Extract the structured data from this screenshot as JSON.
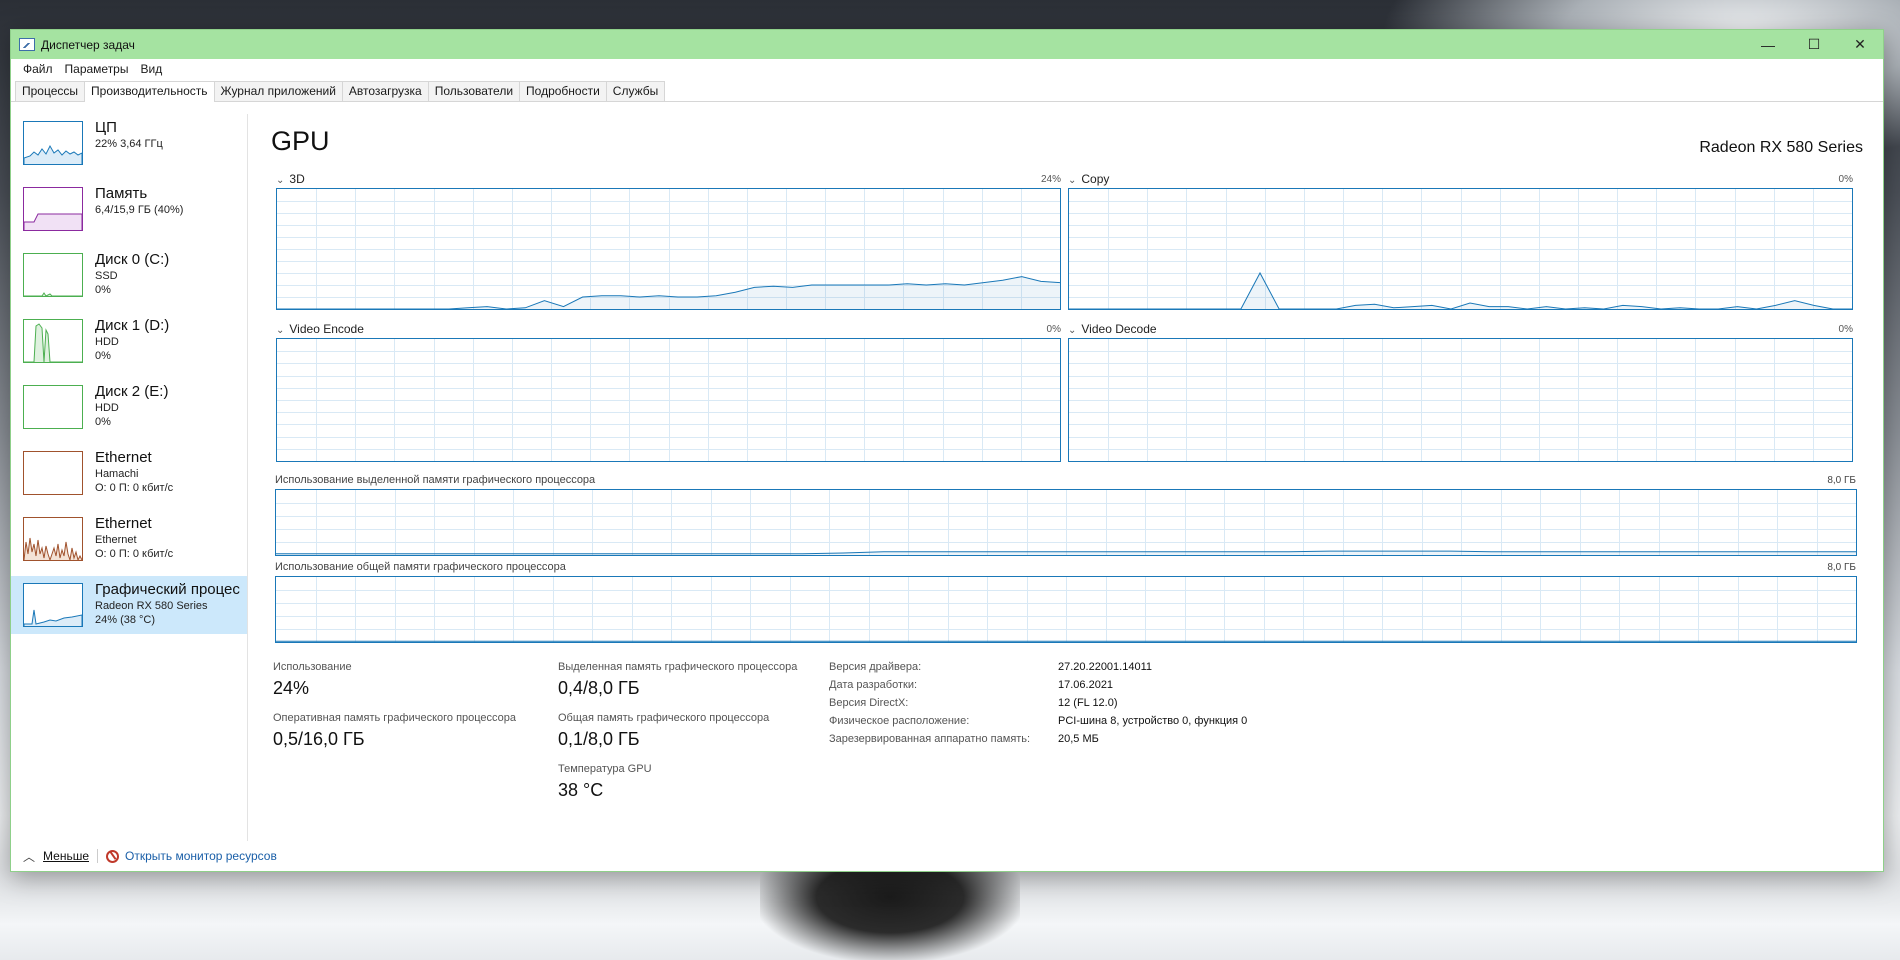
{
  "window": {
    "title": "Диспетчер задач",
    "controls": [
      "—",
      "☐",
      "✕"
    ]
  },
  "menu": [
    "Файл",
    "Параметры",
    "Вид"
  ],
  "tabs": [
    "Процессы",
    "Производительность",
    "Журнал приложений",
    "Автозагрузка",
    "Пользователи",
    "Подробности",
    "Службы"
  ],
  "active_tab": 1,
  "sidebar": [
    {
      "title": "ЦП",
      "line1": "22% 3,64 ГГц",
      "line2": "",
      "color": "#1a78b8"
    },
    {
      "title": "Память",
      "line1": "6,4/15,9 ГБ (40%)",
      "line2": "",
      "color": "#8b2a9f"
    },
    {
      "title": "Диск 0 (C:)",
      "line1": "SSD",
      "line2": "0%",
      "color": "#4caf50"
    },
    {
      "title": "Диск 1 (D:)",
      "line1": "HDD",
      "line2": "0%",
      "color": "#4caf50"
    },
    {
      "title": "Диск 2 (E:)",
      "line1": "HDD",
      "line2": "0%",
      "color": "#4caf50"
    },
    {
      "title": "Ethernet",
      "line1": "Hamachi",
      "line2": "О: 0 П: 0 кбит/с",
      "color": "#a0522d"
    },
    {
      "title": "Ethernet",
      "line1": "Ethernet",
      "line2": "О: 0 П: 0 кбит/с",
      "color": "#a0522d"
    },
    {
      "title": "Графический процес",
      "line1": "Radeon RX 580 Series",
      "line2": "24% (38 °C)",
      "color": "#1a78b8"
    }
  ],
  "active_sidebar": 7,
  "main": {
    "title": "GPU",
    "gpu_name": "Radeon RX 580 Series",
    "engines": [
      {
        "name": "3D",
        "pct": "24%"
      },
      {
        "name": "Copy",
        "pct": "0%"
      },
      {
        "name": "Video Encode",
        "pct": "0%"
      },
      {
        "name": "Video Decode",
        "pct": "0%"
      }
    ],
    "dedicated_label": "Использование выделенной памяти графического процессора",
    "dedicated_max": "8,0 ГБ",
    "shared_label": "Использование общей памяти графического процессора",
    "shared_max": "8,0 ГБ",
    "graph_color": "#1a78b8"
  },
  "stats": {
    "usage_label": "Использование",
    "usage_value": "24%",
    "dedicated_label": "Выделенная память графического процессора",
    "dedicated_value": "0,4/8,0 ГБ",
    "ram_label": "Оперативная память графического процессора",
    "ram_value": "0,5/16,0 ГБ",
    "shared_label": "Общая память графического процессора",
    "shared_value": "0,1/8,0 ГБ",
    "temp_label": "Температура GPU",
    "temp_value": "38 °C"
  },
  "info": [
    {
      "key": "Версия драйвера:",
      "value": "27.20.22001.14011"
    },
    {
      "key": "Дата разработки:",
      "value": "17.06.2021"
    },
    {
      "key": "Версия DirectX:",
      "value": "12 (FL 12.0)"
    },
    {
      "key": "Физическое расположение:",
      "value": "PCI-шина 8, устройство 0, функция 0"
    },
    {
      "key": "Зарезервированная аппаратно память:",
      "value": "20,5 МБ"
    }
  ],
  "footer": {
    "less": "Меньше",
    "resmon": "Открыть монитор ресурсов"
  }
}
